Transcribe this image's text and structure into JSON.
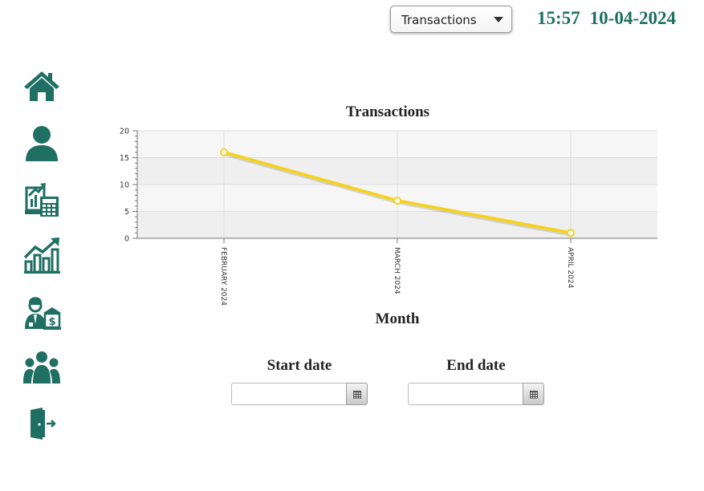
{
  "header": {
    "dropdown": {
      "selected": "Transactions"
    },
    "time": "15:57",
    "date": "10-04-2024"
  },
  "sidebar": {
    "items": [
      {
        "name": "home",
        "icon": "home-icon"
      },
      {
        "name": "profile",
        "icon": "user-icon"
      },
      {
        "name": "accounting",
        "icon": "calculator-report-icon"
      },
      {
        "name": "statistics",
        "icon": "growth-chart-icon"
      },
      {
        "name": "bank-clerk",
        "icon": "banker-icon"
      },
      {
        "name": "customers",
        "icon": "group-icon"
      },
      {
        "name": "logout",
        "icon": "exit-door-icon"
      }
    ]
  },
  "colors": {
    "accent": "#1f6f63",
    "line": "#f4d21f",
    "clock": "#1f7060"
  },
  "chart_data": {
    "type": "line",
    "title": "Transactions",
    "xlabel": "Month",
    "ylabel": "",
    "categories": [
      "FEBRUARY 2024",
      "MARCH 2024",
      "APRIL 2024"
    ],
    "values": [
      16,
      7,
      1
    ],
    "ylim": [
      0,
      20
    ],
    "yticks": [
      0,
      5,
      10,
      15,
      20
    ],
    "grid": true,
    "legend": "none"
  },
  "filters": {
    "start_label": "Start date",
    "start_value": "",
    "end_label": "End date",
    "end_value": ""
  }
}
